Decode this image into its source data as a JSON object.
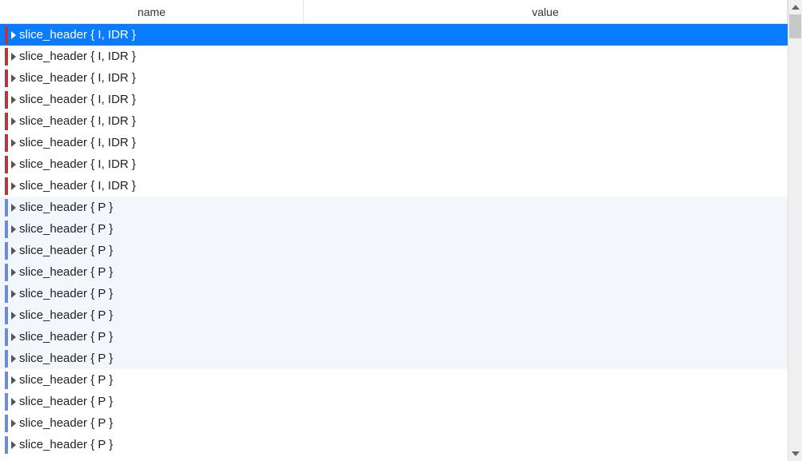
{
  "columns": {
    "name": "name",
    "value": "value"
  },
  "rows": [
    {
      "label": "slice_header { I, IDR }",
      "color": "red",
      "selected": true,
      "alt": false
    },
    {
      "label": "slice_header { I, IDR }",
      "color": "red",
      "selected": false,
      "alt": false
    },
    {
      "label": "slice_header { I, IDR }",
      "color": "red",
      "selected": false,
      "alt": false
    },
    {
      "label": "slice_header { I, IDR }",
      "color": "red",
      "selected": false,
      "alt": false
    },
    {
      "label": "slice_header { I, IDR }",
      "color": "red",
      "selected": false,
      "alt": false
    },
    {
      "label": "slice_header { I, IDR }",
      "color": "red",
      "selected": false,
      "alt": false
    },
    {
      "label": "slice_header { I, IDR }",
      "color": "red",
      "selected": false,
      "alt": false
    },
    {
      "label": "slice_header { I, IDR }",
      "color": "red",
      "selected": false,
      "alt": false
    },
    {
      "label": "slice_header { P }",
      "color": "blue",
      "selected": false,
      "alt": true
    },
    {
      "label": "slice_header { P }",
      "color": "blue",
      "selected": false,
      "alt": true
    },
    {
      "label": "slice_header { P }",
      "color": "blue",
      "selected": false,
      "alt": true
    },
    {
      "label": "slice_header { P }",
      "color": "blue",
      "selected": false,
      "alt": true
    },
    {
      "label": "slice_header { P }",
      "color": "blue",
      "selected": false,
      "alt": true
    },
    {
      "label": "slice_header { P }",
      "color": "blue",
      "selected": false,
      "alt": true
    },
    {
      "label": "slice_header { P }",
      "color": "blue",
      "selected": false,
      "alt": true
    },
    {
      "label": "slice_header { P }",
      "color": "blue",
      "selected": false,
      "alt": true
    },
    {
      "label": "slice_header { P }",
      "color": "blue",
      "selected": false,
      "alt": false
    },
    {
      "label": "slice_header { P }",
      "color": "blue",
      "selected": false,
      "alt": false
    },
    {
      "label": "slice_header { P }",
      "color": "blue",
      "selected": false,
      "alt": false
    },
    {
      "label": "slice_header { P }",
      "color": "blue",
      "selected": false,
      "alt": false
    }
  ]
}
